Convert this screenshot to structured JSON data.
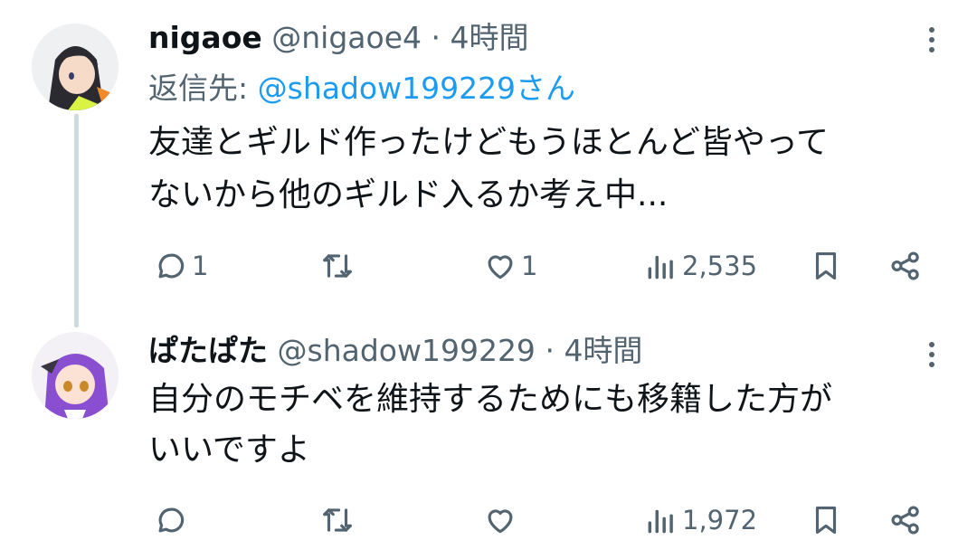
{
  "tweets": [
    {
      "name": "nigaoe",
      "handle": "@nigaoe4",
      "separator": "·",
      "time": "4時間",
      "reply_to_label": "返信先:",
      "reply_to_handle": "@shadow199229さん",
      "text_lines": [
        "友達とギルド作ったけどもうほとんど皆やって",
        "ないから他のギルド入るか考え中..."
      ],
      "replies": "1",
      "likes": "1",
      "views": "2,535"
    },
    {
      "name": "ぱたぱた",
      "handle": "@shadow199229",
      "separator": "·",
      "time": "4時間",
      "text_lines": [
        "自分のモチベを維持するためにも移籍した方が",
        "いいですよ"
      ],
      "replies": "",
      "likes": "",
      "views": "1,972"
    }
  ],
  "icons": [
    "reply-icon",
    "retweet-icon",
    "like-icon",
    "views-icon",
    "bookmark-icon",
    "share-icon",
    "more-icon"
  ],
  "colors": {
    "link": "#1d9bf0",
    "secondary": "#536471",
    "text": "#0f1419",
    "thread_line": "#cfd9de"
  }
}
